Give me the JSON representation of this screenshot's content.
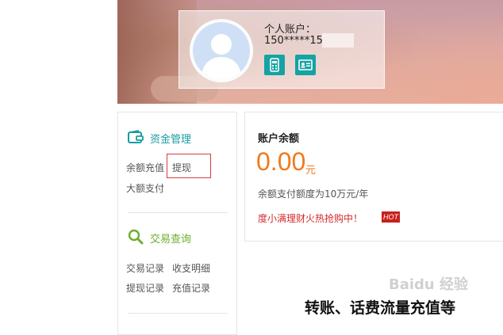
{
  "account_card": {
    "label": "个人账户：",
    "phone": "150*****15",
    "icons": [
      "mobile-icon",
      "id-card-icon"
    ]
  },
  "sidebar": {
    "funds": {
      "title": "资金管理",
      "icon": "wallet-icon",
      "links": [
        "余额充值",
        "提现",
        "大额支付"
      ]
    },
    "query": {
      "title": "交易查询",
      "icon": "search-icon",
      "links": [
        "交易记录",
        "收支明细",
        "提现记录",
        "充值记录"
      ]
    }
  },
  "balance": {
    "title": "账户余额",
    "amount": "0.00",
    "unit": "元",
    "limit_text": "余额支付额度为10万元/年",
    "promo_text": "度小满理财火热抢购中！",
    "promo_badge": "HOT"
  },
  "watermark": "Baidu 经验",
  "caption": "转账、话费流量充值等",
  "colors": {
    "teal": "#1a9ba3",
    "green": "#6fae2d",
    "orange": "#f07a1d",
    "red": "#d42a2a",
    "highlight_box": "#d63c3c"
  }
}
